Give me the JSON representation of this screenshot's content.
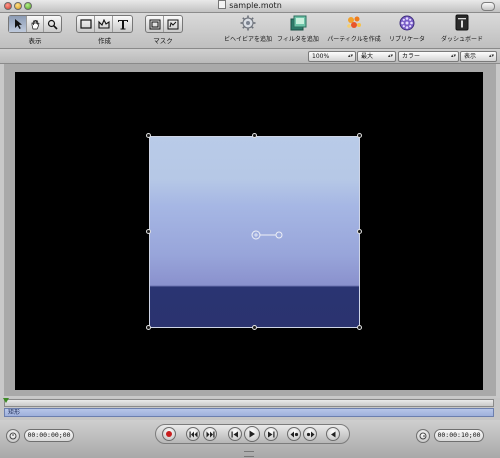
{
  "window": {
    "title": "sample.motn"
  },
  "toolbar": {
    "groups": [
      {
        "label": "表示"
      },
      {
        "label": "作成"
      },
      {
        "label": "マスク"
      }
    ],
    "tools": [
      {
        "label": "ビヘイビアを追加",
        "icon": "behaviors-gear-icon"
      },
      {
        "label": "フィルタを追加",
        "icon": "filter-icon"
      },
      {
        "label": "パーティクルを作成",
        "icon": "particles-icon"
      },
      {
        "label": "リプリケータ",
        "icon": "replicator-icon"
      },
      {
        "label": "ダッシュボード",
        "icon": "dashboard-icon"
      }
    ]
  },
  "view_options": {
    "zoom": "100%",
    "resolution": "最大",
    "channels": "カラー",
    "display": "表示"
  },
  "timeline": {
    "layer_name": "矩形"
  },
  "transport": {
    "current_time": "00:00:00;00",
    "duration": "00:00:10;00"
  },
  "colors": {
    "canvas_bg": "#000000",
    "rect_top": "#b9cbe8",
    "rect_bottom": "#2b336f",
    "track": "#a9b8e0",
    "record": "#c81e1e"
  }
}
